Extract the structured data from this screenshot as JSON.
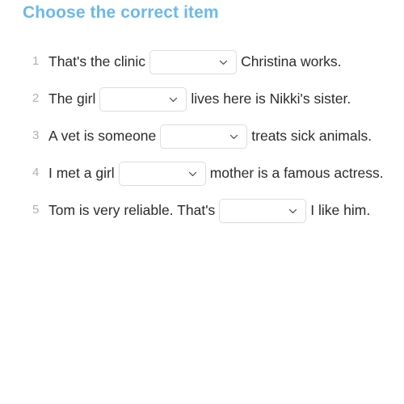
{
  "header": {
    "title": "Choose the correct item",
    "title_color": "#6bb9e8"
  },
  "colors": {
    "page_background": "#ffffff",
    "body_text": "#2b2b2b",
    "question_number": "#b0b0b0",
    "select_border": "#dddddd",
    "chevron": "#444444"
  },
  "select": {
    "placeholder": "",
    "value": "",
    "icon": "chevron-down-icon"
  },
  "questions": [
    {
      "number": "1",
      "text_before": "That's the clinic",
      "text_after": "Christina works.",
      "select_value": ""
    },
    {
      "number": "2",
      "text_before": "The girl",
      "text_after": "lives here is Nikki's sister.",
      "select_value": ""
    },
    {
      "number": "3",
      "text_before": "A vet is someone",
      "text_after": "treats sick animals.",
      "select_value": ""
    },
    {
      "number": "4",
      "text_before": "I met a girl",
      "text_after": "mother is a famous actress.",
      "select_value": ""
    },
    {
      "number": "5",
      "text_before": "Tom is very reliable. That's",
      "text_after": "I like him.",
      "select_value": ""
    }
  ]
}
